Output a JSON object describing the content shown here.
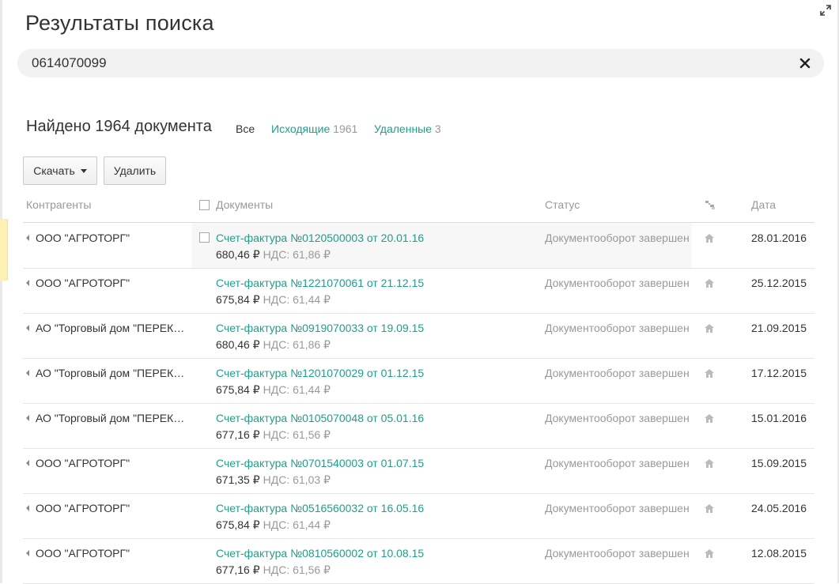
{
  "page": {
    "title": "Результаты поиска"
  },
  "search": {
    "value": "0614070099"
  },
  "summary": {
    "found": "Найдено 1964 документа",
    "filters": [
      {
        "label": "Все",
        "count": ""
      },
      {
        "label": "Исходящие",
        "count": "1961"
      },
      {
        "label": "Удаленные",
        "count": "3"
      }
    ]
  },
  "toolbar": {
    "download_label": "Скачать",
    "delete_label": "Удалить"
  },
  "table": {
    "headers": {
      "contractors": "Контрагенты",
      "documents": "Документы",
      "status": "Статус",
      "date": "Дата"
    },
    "rows": [
      {
        "contractor": "ООО \"АГРОТОРГ\"",
        "document": "Счет-фактура №0120500003 от 20.01.16",
        "amount": "680,46 ₽",
        "vat": "НДС: 61,86 ₽",
        "status": "Документооборот завершен",
        "date": "28.01.2016"
      },
      {
        "contractor": "ООО \"АГРОТОРГ\"",
        "document": "Счет-фактура №1221070061 от 21.12.15",
        "amount": "675,84 ₽",
        "vat": "НДС: 61,44 ₽",
        "status": "Документооборот завершен",
        "date": "25.12.2015"
      },
      {
        "contractor": "АО \"Торговый дом \"ПЕРЕКРЕСТОК\"",
        "document": "Счет-фактура №0919070033 от 19.09.15",
        "amount": "680,46 ₽",
        "vat": "НДС: 61,86 ₽",
        "status": "Документооборот завершен",
        "date": "21.09.2015"
      },
      {
        "contractor": "АО \"Торговый дом \"ПЕРЕКРЕСТОК\"",
        "document": "Счет-фактура №1201070029 от 01.12.15",
        "amount": "675,84 ₽",
        "vat": "НДС: 61,44 ₽",
        "status": "Документооборот завершен",
        "date": "17.12.2015"
      },
      {
        "contractor": "АО \"Торговый дом \"ПЕРЕКРЕСТОК\"",
        "document": "Счет-фактура №0105070048 от 05.01.16",
        "amount": "677,16 ₽",
        "vat": "НДС: 61,56 ₽",
        "status": "Документооборот завершен",
        "date": "15.01.2016"
      },
      {
        "contractor": "ООО \"АГРОТОРГ\"",
        "document": "Счет-фактура №0701540003 от 01.07.15",
        "amount": "671,35 ₽",
        "vat": "НДС: 61,03 ₽",
        "status": "Документооборот завершен",
        "date": "15.09.2015"
      },
      {
        "contractor": "ООО \"АГРОТОРГ\"",
        "document": "Счет-фактура №0516560032 от 16.05.16",
        "amount": "675,84 ₽",
        "vat": "НДС: 61,44 ₽",
        "status": "Документооборот завершен",
        "date": "24.05.2016"
      },
      {
        "contractor": "ООО \"АГРОТОРГ\"",
        "document": "Счет-фактура №0810560002 от 10.08.15",
        "amount": "677,16 ₽",
        "vat": "НДС: 61,56 ₽",
        "status": "Документооборот завершен",
        "date": "12.08.2015"
      }
    ]
  },
  "icons": {
    "expand": "expand-icon",
    "clear": "close-icon",
    "sort": "sort-settings-icon",
    "row_expand": "triangle-left-icon",
    "delivery": "home-icon"
  },
  "colors": {
    "link": "#1e9e8c",
    "muted": "#999999",
    "text": "#333333",
    "search_bg": "#f2f2f2"
  }
}
